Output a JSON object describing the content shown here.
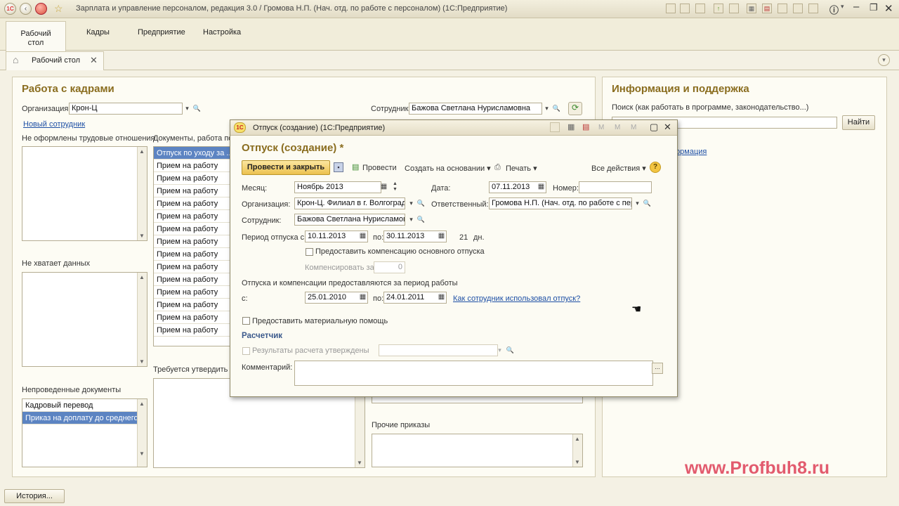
{
  "window": {
    "title": "Зарплата и управление персоналом, редакция 3.0 / Громова Н.П. (Нач. отд. по работе с персоналом)  (1С:Предприятие)"
  },
  "sections": {
    "home_line1": "Рабочий",
    "home_line2": "стол",
    "hr": "Кадры",
    "enterprise": "Предприятие",
    "settings": "Настройка"
  },
  "tab": {
    "label": "Рабочий стол"
  },
  "hr_panel": {
    "title": "Работа с кадрами",
    "org_label": "Организация:",
    "org_value": "Крон-Ц",
    "employee_label": "Сотрудник:",
    "employee_value": "Бажова Светлана Нурисламовна",
    "new_employee_link": "Новый сотрудник",
    "no_employment_label": "Не оформлены трудовые отношения",
    "docs_label": "Документы, работа по",
    "docs": [
      "Отпуск по уходу за ...",
      "Прием на работу",
      "Прием на работу",
      "Прием на работу",
      "Прием на работу",
      "Прием на работу",
      "Прием на работу",
      "Прием на работу",
      "Прием на работу",
      "Прием на работу",
      "Прием на работу",
      "Прием на работу",
      "Прием на работу",
      "Прием на работу",
      "Прием на работу"
    ],
    "missing_data_label": "Не хватает данных",
    "need_approve_label": "Требуется утвердить на",
    "unposted_label": "Непроведенные документы",
    "unposted": [
      "Кадровый перевод",
      "Приказ на доплату до среднего ..."
    ],
    "other_orders_label": "Прочие приказы"
  },
  "info_panel": {
    "title": "Информация и поддержка",
    "search_label": "Поиск (как работать в программе, законодательство...)",
    "find_button": "Найти",
    "link_fragment": "формация"
  },
  "dialog": {
    "window_title": "Отпуск (создание)  (1С:Предприятие)",
    "heading": "Отпуск (создание) *",
    "post_close": "Провести и закрыть",
    "post": "Провести",
    "create_based": "Создать на основании ▾",
    "print": "Печать ▾",
    "all_actions": "Все действия ▾",
    "month_label": "Месяц:",
    "month_value": "Ноябрь 2013",
    "date_label": "Дата:",
    "date_value": "07.11.2013",
    "number_label": "Номер:",
    "number_value": "",
    "org_label": "Организация:",
    "org_value": "Крон-Ц. Филиал в г. Волгоград",
    "responsible_label": "Ответственный:",
    "responsible_value": "Громова Н.П. (Нач. отд. по работе с перс",
    "employee_label": "Сотрудник:",
    "employee_value": "Бажова Светлана Нурисламовна",
    "period_label": "Период отпуска с:",
    "period_from": "10.11.2013",
    "period_to_label": "по:",
    "period_to": "30.11.2013",
    "days_count": "21",
    "days_unit": "дн.",
    "compensation_chk": "Предоставить компенсацию основного отпуска",
    "compensate_for_label": "Компенсировать за:",
    "compensate_for_value": "0",
    "work_period_label": "Отпуска и компенсации предоставляются за период работы",
    "wp_from_label": "с:",
    "wp_from": "25.01.2010",
    "wp_to_label": "по:",
    "wp_to": "24.01.2011",
    "used_vacation_link": "Как сотрудник использовал отпуск?",
    "material_aid_chk": "Предоставить материальную помощь",
    "calculator_header": "Расчетчик",
    "calc_results_chk": "Результаты расчета утверждены",
    "comment_label": "Комментарий:",
    "comment_value": ""
  },
  "footer": {
    "history": "История..."
  },
  "watermark": "www.Profbuh8.ru",
  "colors": {
    "accent_title": "#8a6d1f",
    "link": "#1d4fa5",
    "selection": "#5c84c2",
    "watermark": "#e25b6e",
    "primary_button": "#f3cf6a"
  },
  "icons": [
    "1c-logo-icon",
    "back-icon",
    "forward-icon",
    "star-icon",
    "info-icon",
    "minimize-icon",
    "maximize-icon",
    "close-icon",
    "dropdown-icon",
    "search-icon",
    "refresh-icon",
    "calendar-icon",
    "spin-icon",
    "save-icon",
    "help-icon",
    "printer-icon",
    "hand-cursor-icon"
  ]
}
